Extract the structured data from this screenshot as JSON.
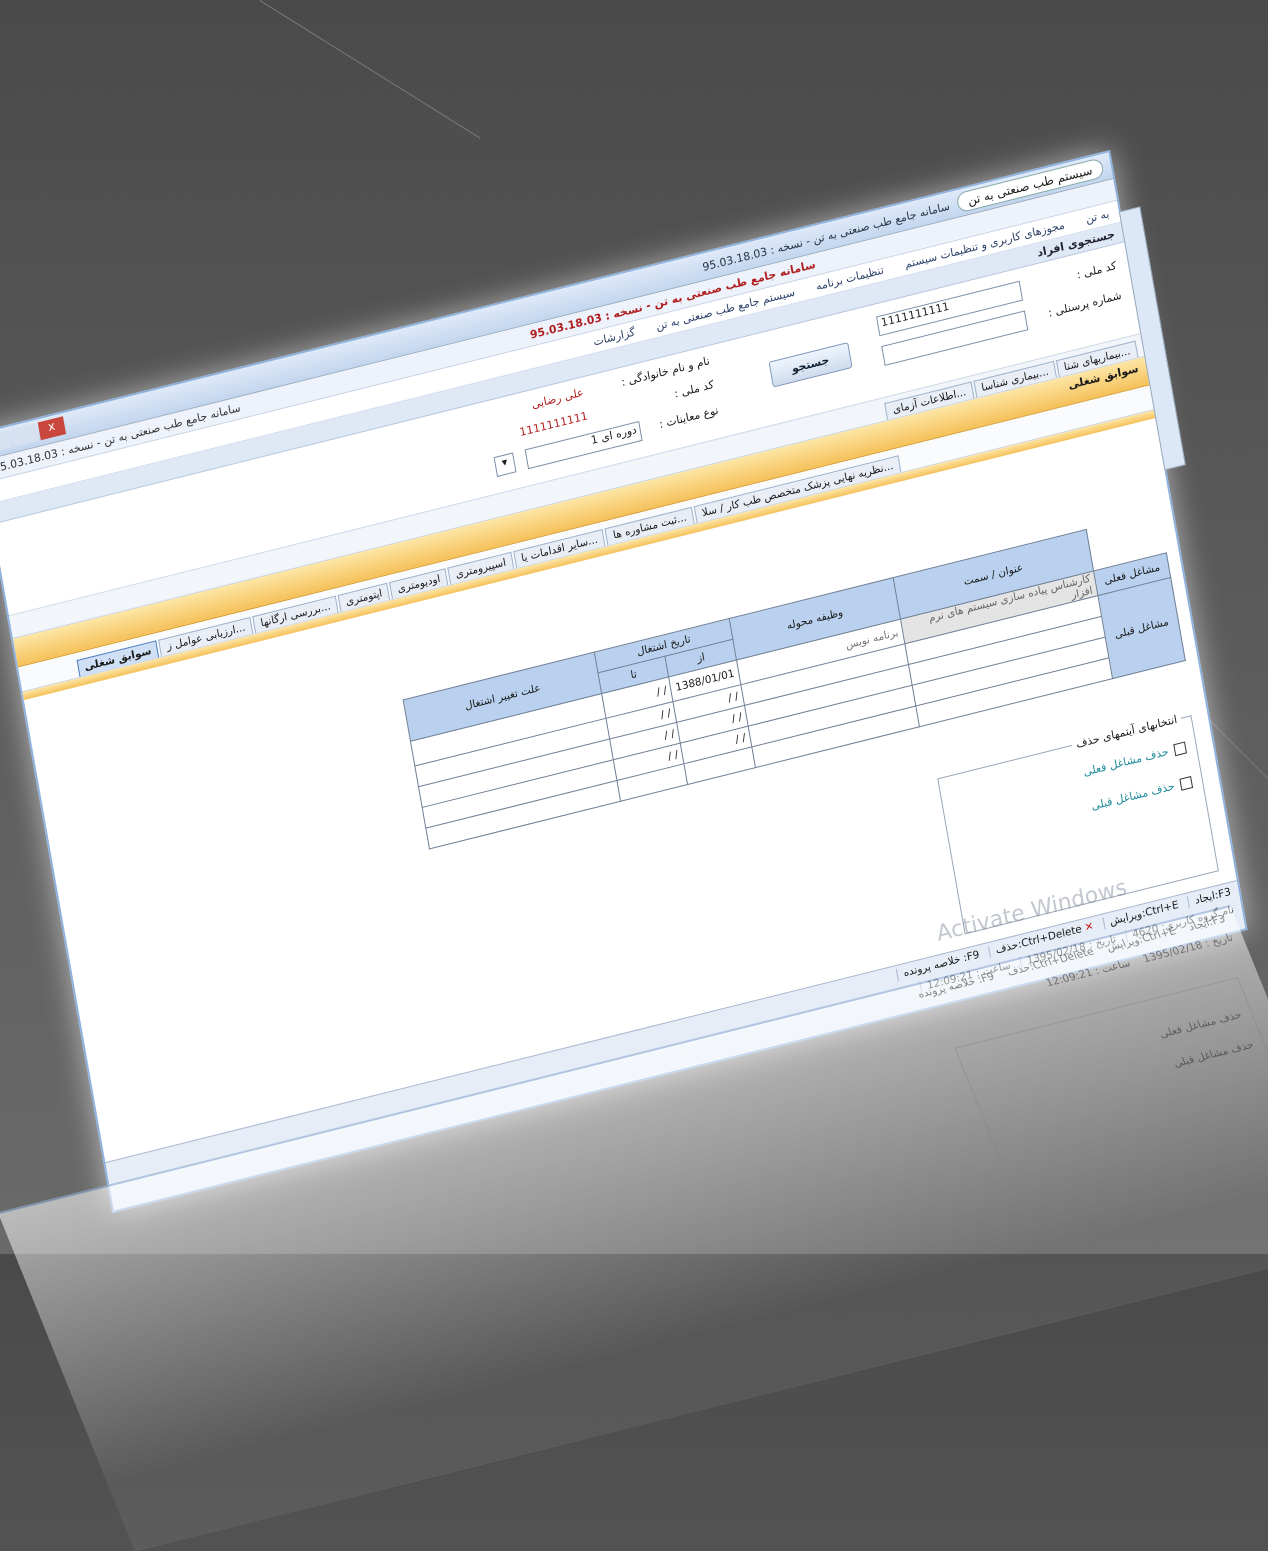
{
  "window": {
    "title": "سامانه جامع طب صنعتی به تن - نسخه : 95.03.18.03",
    "address": "سیستم طب صنعتی به تن",
    "close_glyph": "x"
  },
  "appbar": {
    "main_title": "سامانه جامع طب صنعتی به تن - نسخه : 95.03.18.03",
    "sub_title": "سامانه جامع طب صنعتی به تن - نسخه : 95.03.18.03"
  },
  "menu": [
    "به تن",
    "مجوزهای کاربری و تنظیمات سیستم",
    "تنظیمات برنامه",
    "سیستم جامع طب صنعتی به تن",
    "گزارشات"
  ],
  "search": {
    "header": "جستجوی افراد",
    "national_code_label": "کد ملی :",
    "national_code_value": "1111111111",
    "personnel_label": "شماره پرسنلی :",
    "personnel_value": "",
    "search_button": "جستجو",
    "name_label": "نام و نام خانوادگی :",
    "name_value": "علی رضایی",
    "code_label": "کد ملی :",
    "code_value": "1111111111",
    "exam_type_label": "نوع معاینات :",
    "exam_type_value": "دوره ای 1"
  },
  "tabs_top": [
    "...بیماریهای شنا",
    "...بیماری شناسا",
    "...اطلاعات آزمای",
    "...نظریه نهایی پزشک متخصص طب کار / سلا",
    "...ثبت مشاوره ها",
    "...سایر اقدامات یا",
    "اسپیرومتری",
    "اودیومتری",
    "اپتومتری",
    "...بررسی ارگانها",
    "...ارزیابی عوامل ز",
    "سوابق شغلی"
  ],
  "section_title": "سوابق شغلی",
  "tabs_bottom_active": "سوابق شغلی",
  "grid": {
    "headers": {
      "title": "عنوان / سمت",
      "duty": "وظیفه محوله",
      "date": "تاریخ اشتغال",
      "from": "از",
      "to": "تا",
      "reason": "علت تغییر اشتغال"
    },
    "row_current": "مشاغل فعلی",
    "row_previous": "مشاغل قبلی",
    "current_title": "کارشناس پیاده سازی سیستم های نرم افزار",
    "current_duty": "برنامه نویس",
    "current_from": "1388/01/01",
    "current_to": "/ /",
    "empty_date": "/ /"
  },
  "delete_options": {
    "legend": "انتخابهای آیتمهای حذف",
    "opt1": "حذف مشاغل فعلی",
    "opt2": "حذف مشاغل قبلی"
  },
  "watermark": "Activate Windows",
  "status": {
    "new": "F3:ایجاد",
    "edit": "Ctrl+E:ویرایش",
    "delete": "Ctrl+Delete:حذف",
    "summary": "F9: خلاصه پرونده",
    "group": "نام گروه کاربری: 4620",
    "date": "تاریخ : 1395/02/18",
    "time": "ساعت : 12:09:21"
  }
}
